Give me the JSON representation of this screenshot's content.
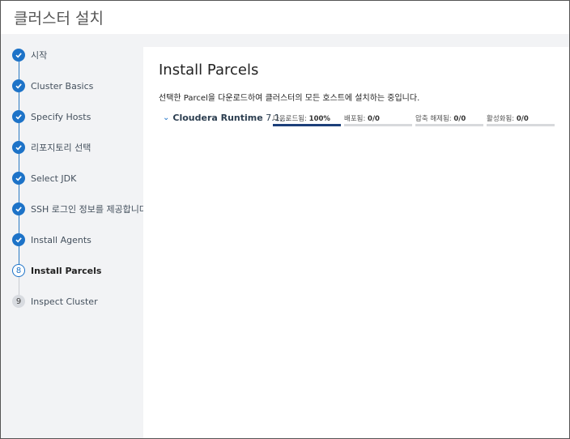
{
  "window": {
    "title": "클러스터 설치"
  },
  "steps": [
    {
      "label": "시작",
      "state": "done"
    },
    {
      "label": "Cluster Basics",
      "state": "done"
    },
    {
      "label": "Specify Hosts",
      "state": "done"
    },
    {
      "label": "리포지토리 선택",
      "state": "done"
    },
    {
      "label": "Select JDK",
      "state": "done"
    },
    {
      "label": "SSH 로그인 정보를 제공합니다.",
      "state": "done"
    },
    {
      "label": "Install Agents",
      "state": "done"
    },
    {
      "label": "Install Parcels",
      "state": "current",
      "num": "8"
    },
    {
      "label": "Inspect Cluster",
      "state": "todo",
      "num": "9"
    }
  ],
  "main": {
    "title": "Install Parcels",
    "description": "선택한 Parcel을 다운로드하여 클러스터의 모든 호스트에 설치하는 중입니다.",
    "parcel": {
      "name": "Cloudera Runtime",
      "version": "7.1...",
      "stats": [
        {
          "label": "다운로드됨:",
          "value": "100%",
          "progress": 1.0
        },
        {
          "label": "배포됨:",
          "value": "0/0",
          "progress": 0
        },
        {
          "label": "압축 해제됨:",
          "value": "0/0",
          "progress": 0
        },
        {
          "label": "활성화됨:",
          "value": "0/0",
          "progress": 0
        }
      ]
    }
  },
  "colors": {
    "accent": "#1d73c8",
    "progress": "#1c3f7a"
  }
}
